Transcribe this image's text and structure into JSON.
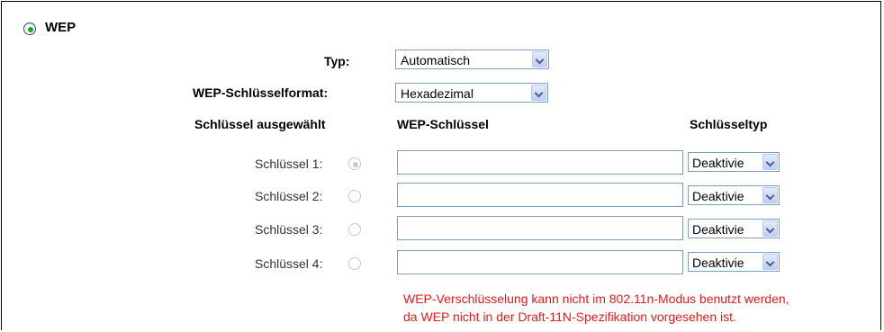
{
  "wep": {
    "title": "WEP",
    "selected": true
  },
  "typ": {
    "label": "Typ:",
    "value": "Automatisch"
  },
  "format": {
    "label": "WEP-Schlüsselformat:",
    "value": "Hexadezimal"
  },
  "headers": {
    "selected": "Schlüssel ausgewählt",
    "key": "WEP-Schlüssel",
    "type": "Schlüsseltyp"
  },
  "keys": [
    {
      "label": "Schlüssel 1:",
      "selected": true,
      "value": "",
      "type": "Deaktivie"
    },
    {
      "label": "Schlüssel 2:",
      "selected": false,
      "value": "",
      "type": "Deaktivie"
    },
    {
      "label": "Schlüssel 3:",
      "selected": false,
      "value": "",
      "type": "Deaktivie"
    },
    {
      "label": "Schlüssel 4:",
      "selected": false,
      "value": "",
      "type": "Deaktivie"
    }
  ],
  "note": {
    "line1": "WEP-Verschlüsselung kann nicht im 802.11n-Modus benutzt werden,",
    "line2": "da WEP nicht in der Draft-11N-Spezifikation vorgesehen ist."
  },
  "colors": {
    "note": "#e31b1b",
    "radio_active": "#21a121",
    "select_border": "#7f9db9"
  }
}
